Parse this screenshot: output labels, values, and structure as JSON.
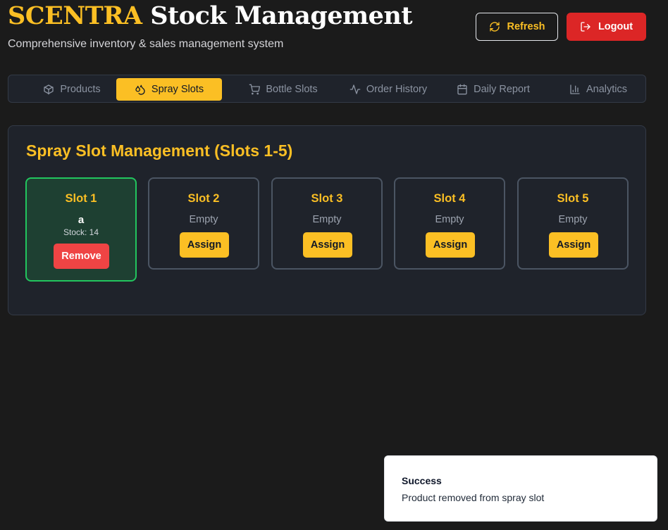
{
  "header": {
    "brand_accent": "SCENTRA",
    "brand_rest": "Stock Management",
    "subtitle": "Comprehensive inventory & sales management system",
    "refresh_label": "Refresh",
    "logout_label": "Logout",
    "refresh_icon": "refresh-icon",
    "logout_icon": "logout-icon"
  },
  "tabs": [
    {
      "label": "Products",
      "icon": "package-icon",
      "active": false
    },
    {
      "label": "Spray Slots",
      "icon": "droplets-icon",
      "active": true
    },
    {
      "label": "Bottle Slots",
      "icon": "cart-icon",
      "active": false
    },
    {
      "label": "Order History",
      "icon": "activity-icon",
      "active": false
    },
    {
      "label": "Daily Report",
      "icon": "calendar-icon",
      "active": false
    },
    {
      "label": "Analytics",
      "icon": "bar-chart-icon",
      "active": false
    }
  ],
  "panel": {
    "title": "Spray Slot Management (Slots 1-5)",
    "slots": [
      {
        "name": "Slot 1",
        "product": "a",
        "stock": "Stock: 14",
        "action": "Remove"
      },
      {
        "name": "Slot 2",
        "status": "Empty",
        "action": "Assign"
      },
      {
        "name": "Slot 3",
        "status": "Empty",
        "action": "Assign"
      },
      {
        "name": "Slot 4",
        "status": "Empty",
        "action": "Assign"
      },
      {
        "name": "Slot 5",
        "status": "Empty",
        "action": "Assign"
      }
    ]
  },
  "toast": {
    "title": "Success",
    "message": "Product removed from spray slot"
  },
  "colors": {
    "accent": "#fbbf24",
    "danger": "#dc2626",
    "success_border": "#22c55e",
    "background": "#1b1b1b"
  }
}
